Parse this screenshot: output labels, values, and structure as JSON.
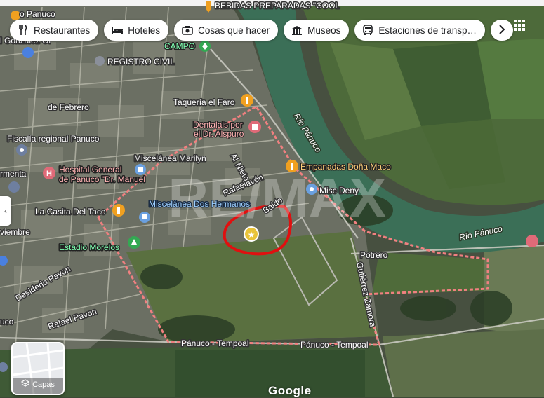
{
  "chips": [
    {
      "label": "Restaurantes",
      "icon": "fork-knife-icon"
    },
    {
      "label": "Hoteles",
      "icon": "bed-icon"
    },
    {
      "label": "Cosas que hacer",
      "icon": "camera-icon"
    },
    {
      "label": "Museos",
      "icon": "museum-icon"
    },
    {
      "label": "Estaciones de transp…",
      "icon": "bus-icon"
    }
  ],
  "chips_more_icon": "chevron-right-icon",
  "apps_icon": "grid-apps-icon",
  "layers": {
    "label": "Capas",
    "icon": "layers-icon"
  },
  "brand": "Google",
  "watermark": "RE/MAX",
  "colors": {
    "boundary": "#f08080",
    "highlight": "#e01010",
    "river": "#3b6f57"
  },
  "places": {
    "bebidas": "BEBIDAS PREPARADAS \"COOL",
    "camposanto": "CAMPO",
    "registro": "REGISTRO CIVIL",
    "taqueria": "Taquería el Faro",
    "dentalais": "Dentalais por",
    "dr_alspuro": "el Dr. Alspuro",
    "fiscalia": "Fiscalía regional Panuco",
    "miscelanea_marilyn": "Miscelánea Marilyn",
    "empanadas": "Empanadas Doña Maco",
    "hospital1": "Hospital General",
    "hospital2": "de Panuco \"Dr. Manuel",
    "farmacia": "rmenta",
    "misc_deny": "Misc Deny",
    "casita_taco": "La Casita Del Taco",
    "misc_dos": "Miscelánea Dos Hermanos",
    "estadio": "Estadio Morelos",
    "febrero": "de Febrero",
    "gonzalez": "l Gonzalez Or",
    "noviembre": "viembre",
    "uco": "uco",
    "panuco_top": "o Panuco"
  },
  "streets": {
    "rio1": "Río Pánuco",
    "rio2": "Río Pánuco",
    "potrero": "Potrero",
    "gutierrez": "Gutiérrez Zamora",
    "panuco_tempoal1": "Pánuco - Tempoal",
    "panuco_tempoal2": "Pánuco - Tempoal",
    "rafael_pavon": "Rafael Pavon",
    "desiderio_pavon": "Desiderio Pavon",
    "pavon": "Pavón",
    "rafael": "Rafael",
    "nieto": "Nieto",
    "baldo": "Baldo",
    "calle_a": "Al"
  }
}
